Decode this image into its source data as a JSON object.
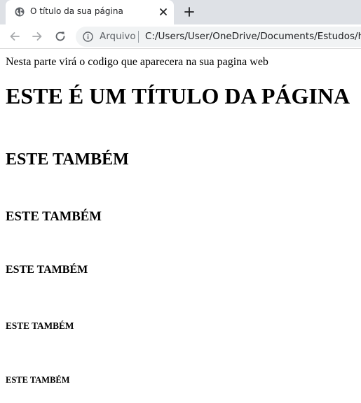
{
  "tab": {
    "title": "O título da sua página"
  },
  "toolbar": {
    "secure_label": "Arquivo",
    "url": "C:/Users/User/OneDrive/Documents/Estudos/html"
  },
  "page": {
    "intro": "Nesta parte virá o codigo que aparecera na sua pagina web",
    "h1": "ESTE É UM TÍTULO DA PÁGINA",
    "h2": "ESTE TAMBÉM",
    "h3": "ESTE TAMBÉM",
    "h4": "ESTE TAMBÉM",
    "h5": "ESTE TAMBÉM",
    "h6": "ESTE TAMBÉM"
  }
}
